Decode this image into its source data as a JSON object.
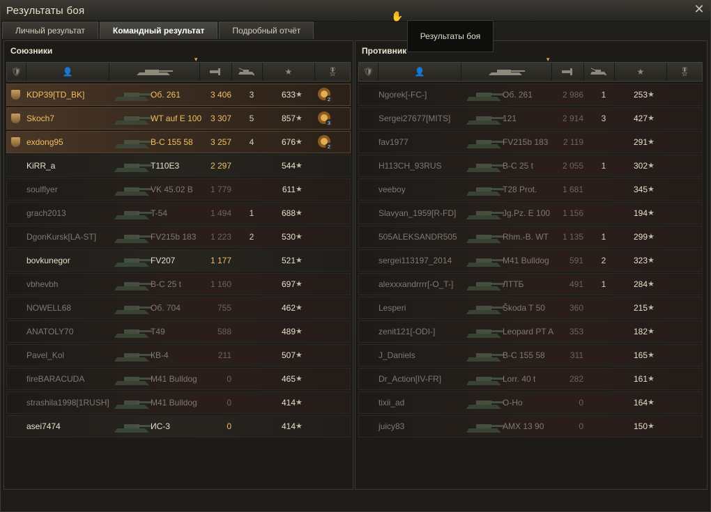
{
  "window": {
    "title": "Результаты боя"
  },
  "tabs": [
    {
      "label": "Личный результат",
      "active": false
    },
    {
      "label": "Командный результат",
      "active": true
    },
    {
      "label": "Подробный отчёт",
      "active": false
    }
  ],
  "tooltip": {
    "text": "Результаты боя"
  },
  "icons": {
    "close": "close-icon",
    "badge": "badge-icon",
    "player": "player-icon",
    "tank": "tank-icon",
    "damage": "damage-icon",
    "kills": "kills-icon",
    "xp": "star-icon",
    "medal": "medal-icon"
  },
  "colors": {
    "highlight": "#f0c060",
    "dead_text": "#7e7a70",
    "alive_text": "#e6e0cc",
    "panel_bg": "#1c1b18"
  },
  "allies": {
    "title": "Союзники",
    "rows": [
      {
        "name": "KDP39[TD_BK]",
        "tank": "Об. 261",
        "damage": "3 406",
        "kills": "3",
        "xp": "633",
        "badge": true,
        "medal": "2",
        "state": "hl"
      },
      {
        "name": "Skoch7",
        "tank": "WT auf E 100",
        "damage": "3 307",
        "kills": "5",
        "xp": "857",
        "badge": true,
        "medal": "3",
        "state": "hl"
      },
      {
        "name": "exdong95",
        "tank": "B-C 155 58",
        "damage": "3 257",
        "kills": "4",
        "xp": "676",
        "badge": true,
        "medal": "2",
        "state": "hl"
      },
      {
        "name": "KiRR_a",
        "tank": "T110E3",
        "damage": "2 297",
        "kills": "",
        "xp": "544",
        "badge": false,
        "medal": "",
        "state": "alive"
      },
      {
        "name": "soulflyer",
        "tank": "VK 45.02 B",
        "damage": "1 779",
        "kills": "",
        "xp": "611",
        "badge": false,
        "medal": "",
        "state": "dead"
      },
      {
        "name": "grach2013",
        "tank": "T-54",
        "damage": "1 494",
        "kills": "1",
        "xp": "688",
        "badge": false,
        "medal": "",
        "state": "dead"
      },
      {
        "name": "DgonKursk[LA-ST]",
        "tank": "FV215b 183",
        "damage": "1 223",
        "kills": "2",
        "xp": "530",
        "badge": false,
        "medal": "",
        "state": "dead"
      },
      {
        "name": "bovkunegor",
        "tank": "FV207",
        "damage": "1 177",
        "kills": "",
        "xp": "521",
        "badge": false,
        "medal": "",
        "state": "alive"
      },
      {
        "name": "vbhevbh",
        "tank": "B-C 25 t",
        "damage": "1 160",
        "kills": "",
        "xp": "697",
        "badge": false,
        "medal": "",
        "state": "dead"
      },
      {
        "name": "NOWELL68",
        "tank": "Об. 704",
        "damage": "755",
        "kills": "",
        "xp": "462",
        "badge": false,
        "medal": "",
        "state": "dead"
      },
      {
        "name": "ANATOLY70",
        "tank": "T49",
        "damage": "588",
        "kills": "",
        "xp": "489",
        "badge": false,
        "medal": "",
        "state": "dead"
      },
      {
        "name": "Pavel_Kol",
        "tank": "КВ-4",
        "damage": "211",
        "kills": "",
        "xp": "507",
        "badge": false,
        "medal": "",
        "state": "dead"
      },
      {
        "name": "fireBARACUDA",
        "tank": "M41 Bulldog",
        "damage": "0",
        "kills": "",
        "xp": "465",
        "badge": false,
        "medal": "",
        "state": "dead"
      },
      {
        "name": "strashila1998[1RUSH]",
        "tank": "M41 Bulldog",
        "damage": "0",
        "kills": "",
        "xp": "414",
        "badge": false,
        "medal": "",
        "state": "dead"
      },
      {
        "name": "asei7474",
        "tank": "ИС-3",
        "damage": "0",
        "kills": "",
        "xp": "414",
        "badge": false,
        "medal": "",
        "state": "alive"
      }
    ]
  },
  "enemies": {
    "title": "Противник",
    "rows": [
      {
        "name": "Ngorek[-FC-]",
        "tank": "Об. 261",
        "damage": "2 986",
        "kills": "1",
        "xp": "253",
        "state": "dead"
      },
      {
        "name": "Sergei27677[MITS]",
        "tank": "121",
        "damage": "2 914",
        "kills": "3",
        "xp": "427",
        "state": "dead"
      },
      {
        "name": "fav1977",
        "tank": "FV215b 183",
        "damage": "2 119",
        "kills": "",
        "xp": "291",
        "state": "dead"
      },
      {
        "name": "H113CH_93RUS",
        "tank": "B-C 25 t",
        "damage": "2 055",
        "kills": "1",
        "xp": "302",
        "state": "dead"
      },
      {
        "name": "veeboy",
        "tank": "T28 Prot.",
        "damage": "1 681",
        "kills": "",
        "xp": "345",
        "state": "dead"
      },
      {
        "name": "Slavyan_1959[R-FD]",
        "tank": "Jg.Pz. E 100",
        "damage": "1 156",
        "kills": "",
        "xp": "194",
        "state": "dead"
      },
      {
        "name": "505ALEKSANDR505",
        "tank": "Rhm.-B. WT",
        "damage": "1 135",
        "kills": "1",
        "xp": "299",
        "state": "dead"
      },
      {
        "name": "sergei113197_2014",
        "tank": "M41 Bulldog",
        "damage": "591",
        "kills": "2",
        "xp": "323",
        "state": "dead"
      },
      {
        "name": "alexxxandrrrr[-O_T-]",
        "tank": "ЛТТБ",
        "damage": "491",
        "kills": "1",
        "xp": "284",
        "state": "dead"
      },
      {
        "name": "Lesperi",
        "tank": "Škoda T 50",
        "damage": "360",
        "kills": "",
        "xp": "215",
        "state": "dead"
      },
      {
        "name": "zenit121[-ODI-]",
        "tank": "Leopard PT A",
        "damage": "353",
        "kills": "",
        "xp": "182",
        "state": "dead"
      },
      {
        "name": "J_Daniels",
        "tank": "B-C 155 58",
        "damage": "311",
        "kills": "",
        "xp": "165",
        "state": "dead"
      },
      {
        "name": "Dr_Action[IV-FR]",
        "tank": "Lorr. 40 t",
        "damage": "282",
        "kills": "",
        "xp": "161",
        "state": "dead"
      },
      {
        "name": "tixii_ad",
        "tank": "O-Ho",
        "damage": "0",
        "kills": "",
        "xp": "164",
        "state": "dead"
      },
      {
        "name": "juicy83",
        "tank": "AMX 13 90",
        "damage": "0",
        "kills": "",
        "xp": "150",
        "state": "dead"
      }
    ]
  }
}
